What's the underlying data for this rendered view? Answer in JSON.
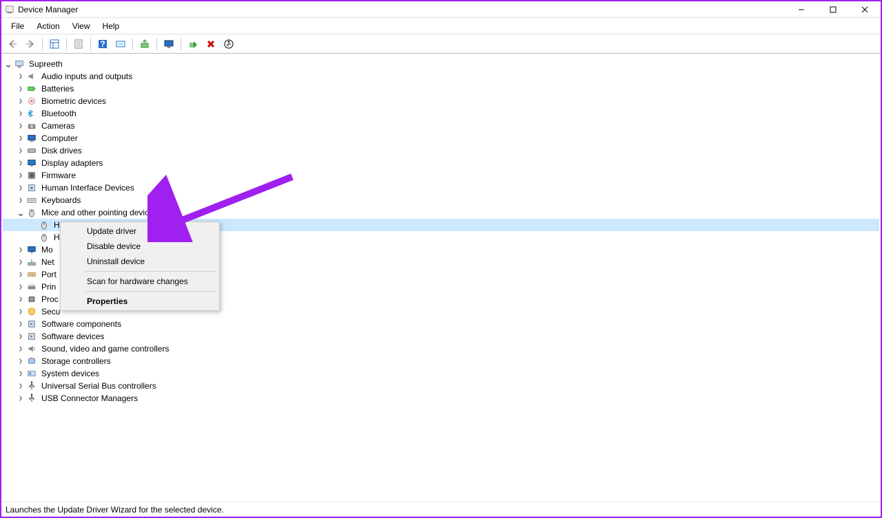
{
  "title": "Device Manager",
  "menus": [
    "File",
    "Action",
    "View",
    "Help"
  ],
  "tree": {
    "root": "Supreeth",
    "categories": [
      {
        "label": "Audio inputs and outputs",
        "icon": "speaker"
      },
      {
        "label": "Batteries",
        "icon": "battery"
      },
      {
        "label": "Biometric devices",
        "icon": "biometric"
      },
      {
        "label": "Bluetooth",
        "icon": "bluetooth"
      },
      {
        "label": "Cameras",
        "icon": "camera"
      },
      {
        "label": "Computer",
        "icon": "computer"
      },
      {
        "label": "Disk drives",
        "icon": "disk"
      },
      {
        "label": "Display adapters",
        "icon": "display"
      },
      {
        "label": "Firmware",
        "icon": "firmware"
      },
      {
        "label": "Human Interface Devices",
        "icon": "hid"
      },
      {
        "label": "Keyboards",
        "icon": "keyboard"
      },
      {
        "label": "Mice and other pointing devices",
        "icon": "mouse",
        "expanded": true,
        "children": [
          {
            "label": "HID-compliant mouse",
            "icon": "mouse",
            "selected": true
          },
          {
            "label": "HID-compliant mouse",
            "icon": "mouse"
          }
        ]
      },
      {
        "label": "Mo",
        "icon": "monitor",
        "truncated": true
      },
      {
        "label": "Net",
        "icon": "network",
        "truncated": true
      },
      {
        "label": "Port",
        "icon": "port",
        "truncated": true
      },
      {
        "label": "Prin",
        "icon": "printer",
        "truncated": true
      },
      {
        "label": "Proc",
        "icon": "processor",
        "truncated": true
      },
      {
        "label": "Secu",
        "icon": "security",
        "truncated": true
      },
      {
        "label": "Software components",
        "icon": "software"
      },
      {
        "label": "Software devices",
        "icon": "software"
      },
      {
        "label": "Sound, video and game controllers",
        "icon": "sound"
      },
      {
        "label": "Storage controllers",
        "icon": "storage"
      },
      {
        "label": "System devices",
        "icon": "system"
      },
      {
        "label": "Universal Serial Bus controllers",
        "icon": "usb"
      },
      {
        "label": "USB Connector Managers",
        "icon": "usb"
      }
    ]
  },
  "context_menu": {
    "items": [
      {
        "label": "Update driver"
      },
      {
        "label": "Disable device"
      },
      {
        "label": "Uninstall device"
      },
      {
        "sep": true
      },
      {
        "label": "Scan for hardware changes"
      },
      {
        "sep": true
      },
      {
        "label": "Properties",
        "bold": true
      }
    ]
  },
  "statusbar": "Launches the Update Driver Wizard for the selected device."
}
